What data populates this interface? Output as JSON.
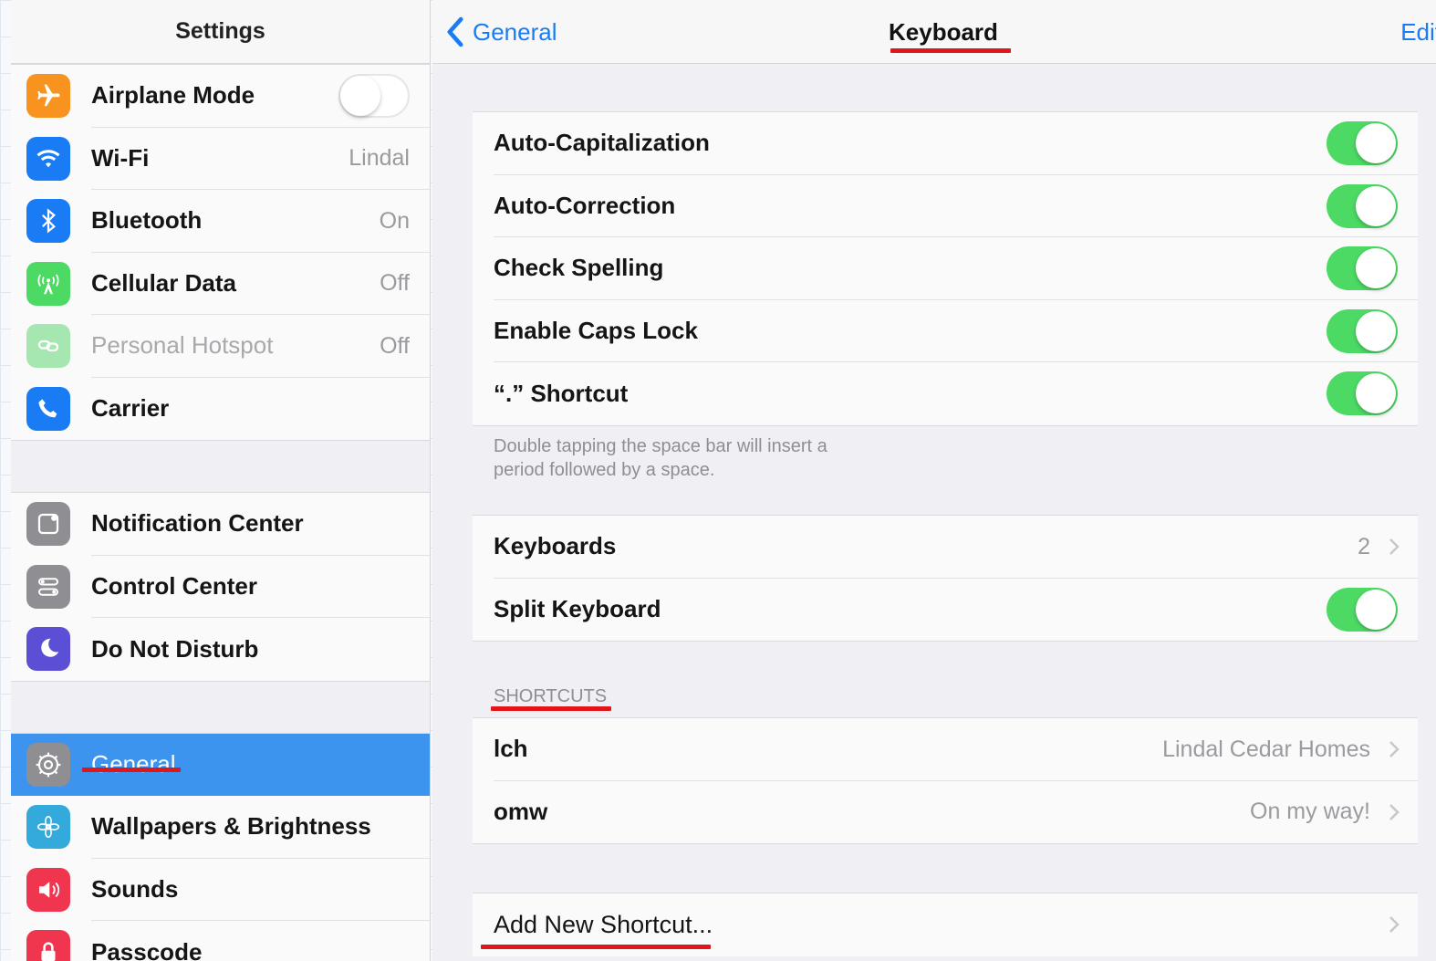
{
  "sidebar": {
    "title": "Settings",
    "groups": [
      [
        {
          "label": "Airplane Mode",
          "icon": "airplane-icon",
          "color": "#f7931e",
          "toggle": "off"
        },
        {
          "label": "Wi-Fi",
          "icon": "wifi-icon",
          "color": "#1a7cf5",
          "value": "Lindal"
        },
        {
          "label": "Bluetooth",
          "icon": "bluetooth-icon",
          "color": "#1a7cf5",
          "value": "On"
        },
        {
          "label": "Cellular Data",
          "icon": "cellular-icon",
          "color": "#4cd964",
          "value": "Off"
        },
        {
          "label": "Personal Hotspot",
          "icon": "hotspot-icon",
          "color": "#a6e6b0",
          "value": "Off",
          "dim": true
        },
        {
          "label": "Carrier",
          "icon": "phone-icon",
          "color": "#1a7cf5"
        }
      ],
      [
        {
          "label": "Notification Center",
          "icon": "notification-icon",
          "color": "#8e8e93"
        },
        {
          "label": "Control Center",
          "icon": "control-center-icon",
          "color": "#8e8e93"
        },
        {
          "label": "Do Not Disturb",
          "icon": "moon-icon",
          "color": "#5b4fd6"
        }
      ],
      [
        {
          "label": "General",
          "icon": "gear-icon",
          "color": "#8e8e93",
          "selected": true
        },
        {
          "label": "Wallpapers & Brightness",
          "icon": "flower-icon",
          "color": "#34aadc"
        },
        {
          "label": "Sounds",
          "icon": "speaker-icon",
          "color": "#f0354f"
        },
        {
          "label": "Passcode",
          "icon": "lock-icon",
          "color": "#f0354f"
        }
      ]
    ]
  },
  "header": {
    "back_label": "General",
    "title": "Keyboard",
    "edit_label": "Edit"
  },
  "toggles_group": [
    {
      "label": "Auto-Capitalization",
      "on": true
    },
    {
      "label": "Auto-Correction",
      "on": true
    },
    {
      "label": "Check Spelling",
      "on": true
    },
    {
      "label": "Enable Caps Lock",
      "on": true
    },
    {
      "label": "“.” Shortcut",
      "on": true
    }
  ],
  "footnote": "Double tapping the space bar will insert a period followed by a space.",
  "keyboards_group": {
    "keyboards_label": "Keyboards",
    "keyboards_value": "2",
    "split_label": "Split Keyboard",
    "split_on": true
  },
  "shortcuts": {
    "section_title": "SHORTCUTS",
    "items": [
      {
        "label": "lch",
        "value": "Lindal Cedar Homes"
      },
      {
        "label": "omw",
        "value": "On my way!"
      }
    ],
    "add_label": "Add New Shortcut..."
  },
  "colors": {
    "accent": "#1a7cf5",
    "toggle_on": "#4cd964",
    "selected_row": "#3d94ee",
    "annotation_underline": "#e0161b"
  }
}
